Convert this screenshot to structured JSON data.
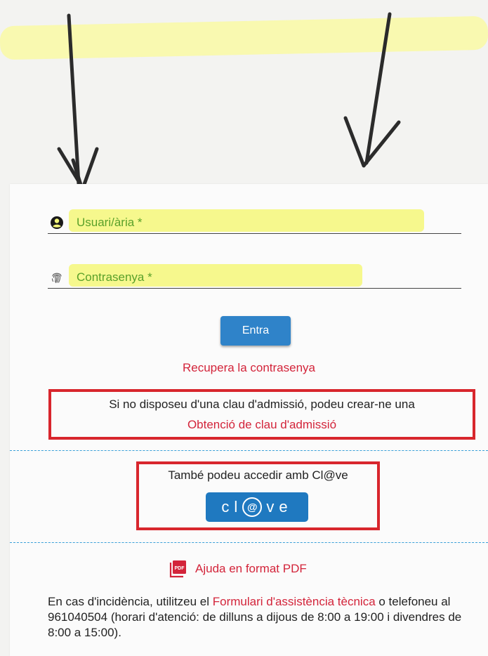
{
  "login": {
    "user_label": "Usuari/ària *",
    "password_label": "Contrasenya *",
    "submit_label": "Entra",
    "recover_link": "Recupera la contrasenya"
  },
  "no_key": {
    "text": "Si no disposeu d'una clau d'admissió, podeu crear-ne una",
    "link": "Obtenció de clau d'admissió"
  },
  "clave": {
    "text": "També podeu accedir amb Cl@ve",
    "button_prefix": "cl",
    "button_at": "@",
    "button_suffix": "ve"
  },
  "help": {
    "icon_text": "PDF",
    "label": "Ajuda en format PDF"
  },
  "incident": {
    "prefix": "En cas d'incidència, utilitzeu el ",
    "link": "Formulari d'assistència tècnica",
    "rest": " o telefoneu al 961040504 (horari d'atenció: de dilluns a dijous de 8:00 a 19:00 i divendres de 8:00 a 15:00)."
  },
  "colors": {
    "accent_red": "#d3243a",
    "button_blue": "#2f83c9",
    "label_green": "#5aa12a",
    "highlight_yellow": "#f4f779",
    "box_red": "#d8262d"
  },
  "icons": {
    "user": "user-circle-icon",
    "password": "fingerprint-icon",
    "pdf": "pdf-file-icon"
  }
}
